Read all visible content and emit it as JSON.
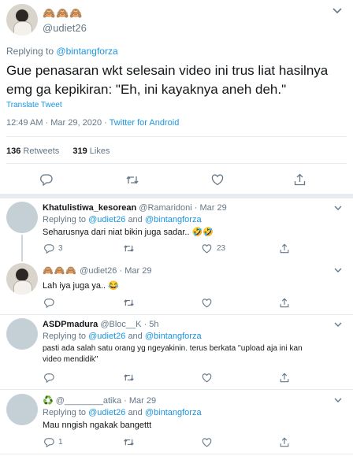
{
  "main_tweet": {
    "display_name": "🙈🙈🙈",
    "handle": "@udiet26",
    "reply_prefix": "Replying to",
    "reply_to": "@bintangforza",
    "text_line1": "Gue penasaran wkt selesain video ini trus liat hasilnya",
    "text_line2": "emg ga kepikiran: \"Eh, ini kayaknya aneh deh.\"",
    "translate": "Translate Tweet",
    "time": "12:49 AM · Mar 29, 2020 · ",
    "source": "Twitter for Android",
    "retweets_count": "136",
    "retweets_label": "Retweets",
    "likes_count": "319",
    "likes_label": "Likes"
  },
  "replies": [
    {
      "display_name": "Khatulistiwa_kesorean",
      "handle": "@Ramaridoni",
      "dot_time": "· Mar 29",
      "reply_prefix": "Replying to",
      "reply_to_1": "@udiet26",
      "reply_and": "and",
      "reply_to_2": "@bintangforza",
      "text": "Seharusnya dari niat bikin juga sadar.. 🤣🤣",
      "reply_count": "3",
      "like_count": "23"
    },
    {
      "display_name": "🙈🙈🙈",
      "handle": "@udiet26",
      "dot_time": "· Mar 29",
      "text": "Lah iya juga ya.. 😂"
    },
    {
      "display_name": "ASDPmadura",
      "handle": "@Bloc__K",
      "dot_time": "· 5h",
      "reply_prefix": "Replying to",
      "reply_to_1": "@udiet26",
      "reply_and": "and",
      "reply_to_2": "@bintangforza",
      "text_line1": "pasti ada salah satu orang yg ngeyakinin. terus berkata ''upload aja ini kan",
      "text_line2": "video mendidik\""
    },
    {
      "display_name": "♻️",
      "handle": "@________atika",
      "dot_time": "· Mar 29",
      "reply_prefix": "Replying to",
      "reply_to_1": "@udiet26",
      "reply_and": "and",
      "reply_to_2": "@bintangforza",
      "text": "Mau nngish ngakak bangettt",
      "reply_count": "1"
    }
  ],
  "colors": {
    "accent": "#1b95e0",
    "muted": "#657786",
    "divider": "#e6ecf0",
    "text": "#14171a"
  }
}
